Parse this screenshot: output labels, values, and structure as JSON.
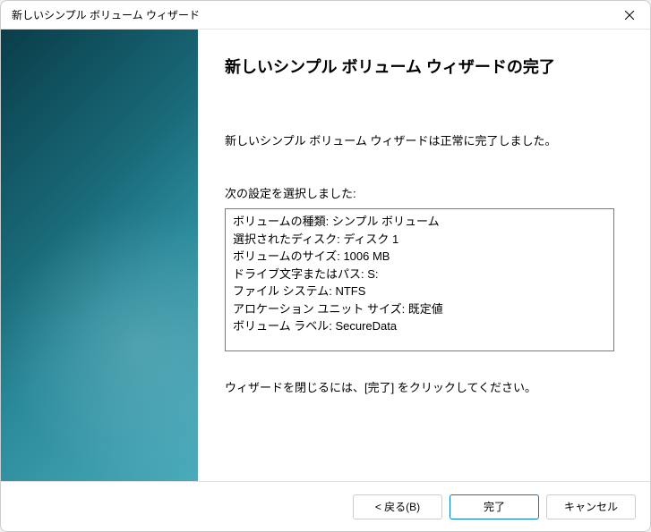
{
  "window": {
    "title": "新しいシンプル ボリューム ウィザード"
  },
  "main": {
    "heading": "新しいシンプル ボリューム ウィザードの完了",
    "message": "新しいシンプル ボリューム ウィザードは正常に完了しました。",
    "settings_label": "次の設定を選択しました:",
    "settings": [
      "ボリュームの種類: シンプル ボリューム",
      "選択されたディスク: ディスク 1",
      "ボリュームのサイズ: 1006 MB",
      "ドライブ文字またはパス: S:",
      "ファイル システム: NTFS",
      "アロケーション ユニット サイズ: 既定値",
      "ボリューム ラベル: SecureData"
    ],
    "instruction": "ウィザードを閉じるには、[完了] をクリックしてください。"
  },
  "buttons": {
    "back": "< 戻る(B)",
    "finish": "完了",
    "cancel": "キャンセル"
  }
}
